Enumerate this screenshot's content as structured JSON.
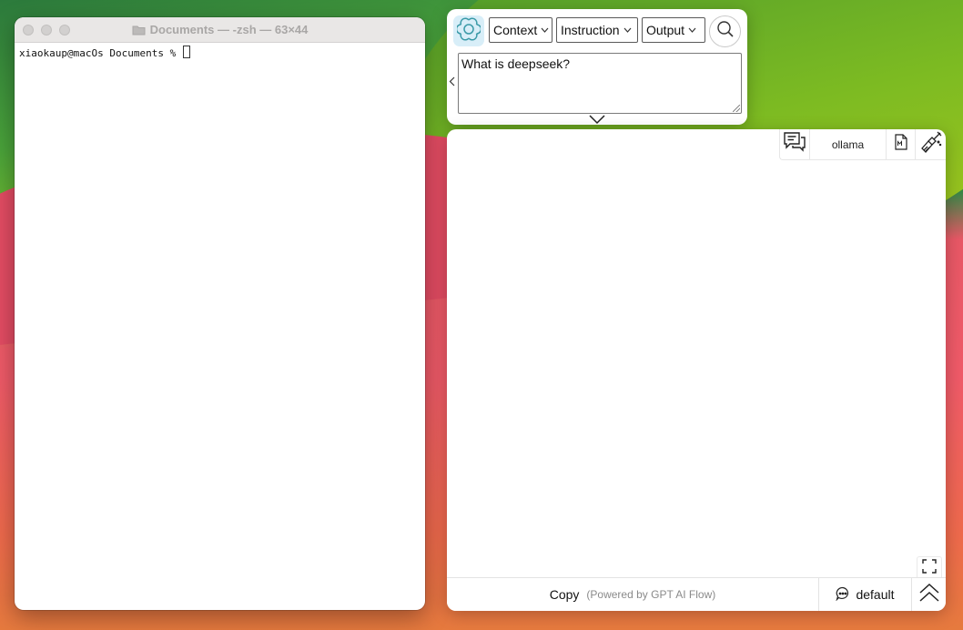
{
  "terminal": {
    "title": "Documents — -zsh — 63×44",
    "prompt_line": "xiaokaup@macOs Documents % "
  },
  "prompt_panel": {
    "context_label": "Context",
    "instruction_label": "Instruction",
    "output_label": "Output",
    "prompt_text": "What is deepseek?",
    "icons": [
      "openai-logo-icon",
      "search-icon",
      "chevron-left-icon",
      "chevron-down-icon"
    ]
  },
  "output_panel": {
    "model_name": "ollama",
    "copy_label": "Copy",
    "powered_by": "(Powered by GPT AI Flow)",
    "default_label": "default",
    "icons": [
      "chat-bubbles-icon",
      "markdown-file-icon",
      "clean-broom-icon",
      "fullscreen-icon",
      "chat-icon",
      "double-chevron-up-icon"
    ]
  },
  "colors": {
    "logo_bg": "#d8eef8",
    "logo_stroke": "#3a9aa8",
    "terminal_title": "#a9a7a6"
  }
}
